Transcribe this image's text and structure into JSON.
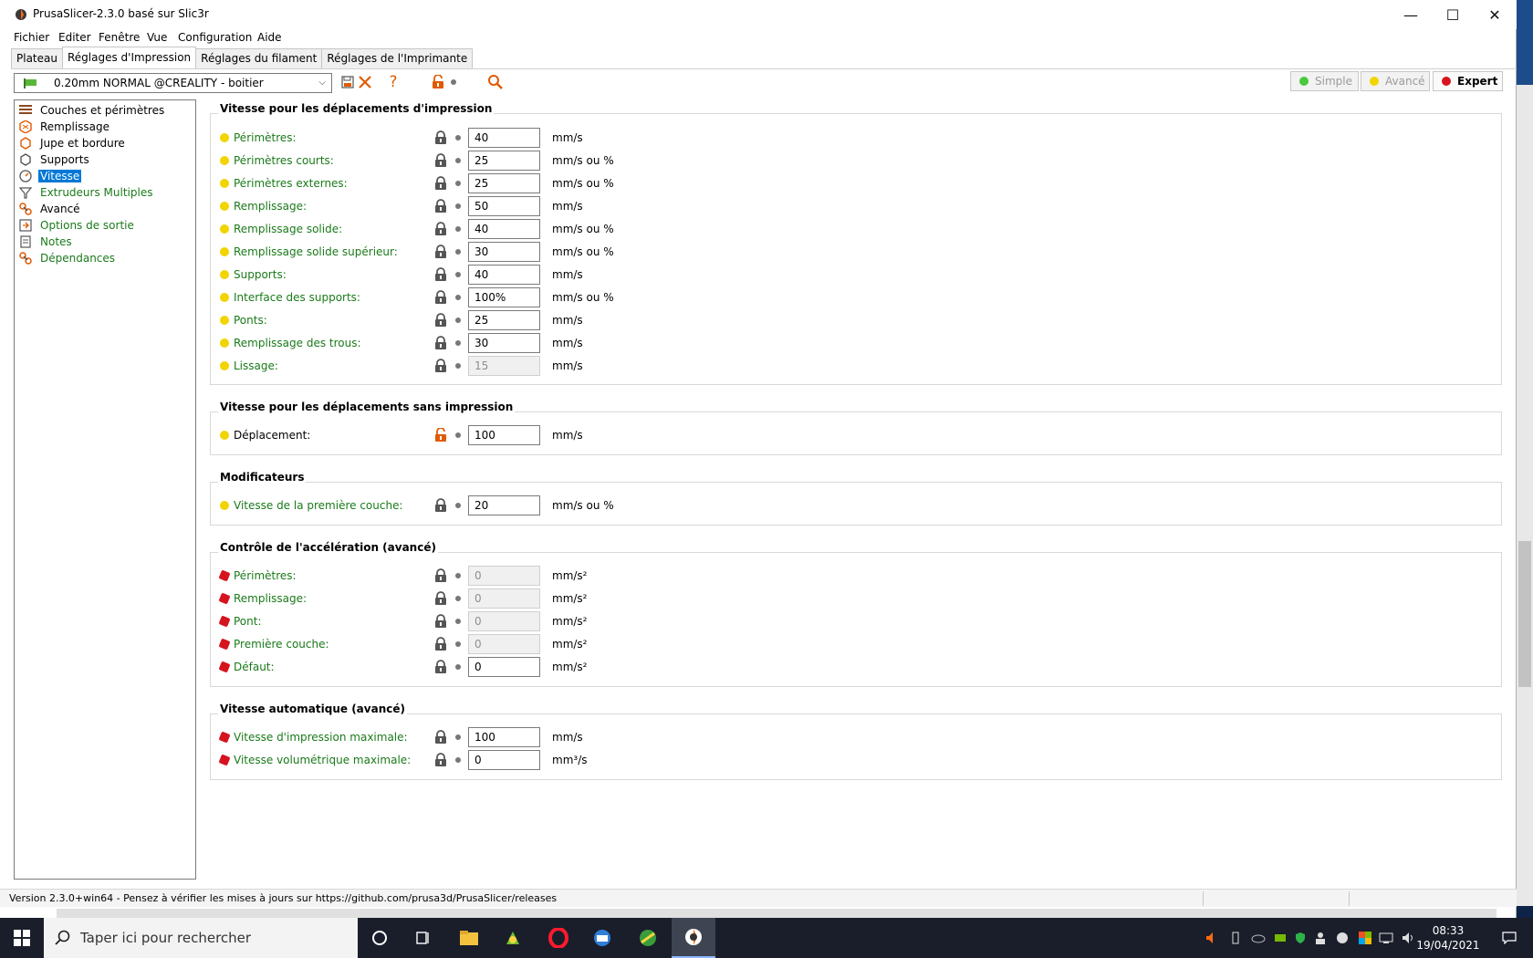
{
  "window": {
    "title": "PrusaSlicer-2.3.0 basé sur Slic3r",
    "controls": {
      "minimize": "—",
      "maximize": "☐",
      "close": "✕"
    }
  },
  "menu": [
    "Fichier",
    "Editer",
    "Fenêtre",
    "Vue",
    "Configuration",
    "Aide"
  ],
  "tabs": [
    {
      "label": "Plateau",
      "active": false
    },
    {
      "label": "Réglages d'Impression",
      "active": true
    },
    {
      "label": "Réglages du filament",
      "active": false
    },
    {
      "label": "Réglages de l'Imprimante",
      "active": false
    }
  ],
  "preset": {
    "name": "0.20mm NORMAL @CREALITY - boitier",
    "icon": "green-flag-icon"
  },
  "toolbar": {
    "save_icon": "save-icon",
    "delete_icon": "delete-x-icon",
    "help_label": "?",
    "lock_icon": "unlock-icon",
    "search_icon": "search-icon"
  },
  "modes": [
    {
      "label": "Simple",
      "color": "#49c93b",
      "active": false
    },
    {
      "label": "Avancé",
      "color": "#f2d400",
      "active": false
    },
    {
      "label": "Expert",
      "color": "#d6141e",
      "active": true
    }
  ],
  "sidebar": [
    {
      "label": "Couches et périmètres",
      "icon": "layers-icon",
      "green": false,
      "selected": false
    },
    {
      "label": "Remplissage",
      "icon": "infill-icon",
      "green": false,
      "selected": false
    },
    {
      "label": "Jupe et bordure",
      "icon": "skirt-icon",
      "green": false,
      "selected": false
    },
    {
      "label": "Supports",
      "icon": "support-icon",
      "green": false,
      "selected": false
    },
    {
      "label": "Vitesse",
      "icon": "speed-gauge-icon",
      "green": false,
      "selected": true
    },
    {
      "label": "Extrudeurs Multiples",
      "icon": "funnel-icon",
      "green": true,
      "selected": false
    },
    {
      "label": "Avancé",
      "icon": "wrench-icon",
      "green": false,
      "selected": false
    },
    {
      "label": "Options de sortie",
      "icon": "output-icon",
      "green": true,
      "selected": false
    },
    {
      "label": "Notes",
      "icon": "note-icon",
      "green": true,
      "selected": false
    },
    {
      "label": "Dépendances",
      "icon": "wrench-icon",
      "green": true,
      "selected": false
    }
  ],
  "groups": [
    {
      "title": "Vitesse pour les déplacements d'impression",
      "rows": [
        {
          "label": "Périmètres:",
          "value": "40",
          "unit": "mm/s",
          "bullet": "yellow",
          "disabled": false,
          "green": true,
          "unlocked": false
        },
        {
          "label": "Périmètres courts:",
          "value": "25",
          "unit": "mm/s ou %",
          "bullet": "yellow",
          "disabled": false,
          "green": true,
          "unlocked": false
        },
        {
          "label": "Périmètres externes:",
          "value": "25",
          "unit": "mm/s ou %",
          "bullet": "yellow",
          "disabled": false,
          "green": true,
          "unlocked": false
        },
        {
          "label": "Remplissage:",
          "value": "50",
          "unit": "mm/s",
          "bullet": "yellow",
          "disabled": false,
          "green": true,
          "unlocked": false
        },
        {
          "label": "Remplissage solide:",
          "value": "40",
          "unit": "mm/s ou %",
          "bullet": "yellow",
          "disabled": false,
          "green": true,
          "unlocked": false
        },
        {
          "label": "Remplissage solide supérieur:",
          "value": "30",
          "unit": "mm/s ou %",
          "bullet": "yellow",
          "disabled": false,
          "green": true,
          "unlocked": false
        },
        {
          "label": "Supports:",
          "value": "40",
          "unit": "mm/s",
          "bullet": "yellow",
          "disabled": false,
          "green": true,
          "unlocked": false
        },
        {
          "label": "Interface des supports:",
          "value": "100%",
          "unit": "mm/s ou %",
          "bullet": "yellow",
          "disabled": false,
          "green": true,
          "unlocked": false
        },
        {
          "label": "Ponts:",
          "value": "25",
          "unit": "mm/s",
          "bullet": "yellow",
          "disabled": false,
          "green": true,
          "unlocked": false
        },
        {
          "label": "Remplissage des trous:",
          "value": "30",
          "unit": "mm/s",
          "bullet": "yellow",
          "disabled": false,
          "green": true,
          "unlocked": false
        },
        {
          "label": "Lissage:",
          "value": "15",
          "unit": "mm/s",
          "bullet": "yellow",
          "disabled": true,
          "green": true,
          "unlocked": false
        }
      ]
    },
    {
      "title": "Vitesse pour les déplacements sans impression",
      "rows": [
        {
          "label": "Déplacement:",
          "value": "100",
          "unit": "mm/s",
          "bullet": "yellow",
          "disabled": false,
          "green": false,
          "unlocked": true
        }
      ]
    },
    {
      "title": "Modificateurs",
      "rows": [
        {
          "label": "Vitesse de la première couche:",
          "value": "20",
          "unit": "mm/s ou %",
          "bullet": "yellow",
          "disabled": false,
          "green": true,
          "unlocked": false
        }
      ]
    },
    {
      "title": "Contrôle de l'accélération (avancé)",
      "rows": [
        {
          "label": "Périmètres:",
          "value": "0",
          "unit": "mm/s²",
          "bullet": "red",
          "disabled": true,
          "green": true,
          "unlocked": false
        },
        {
          "label": "Remplissage:",
          "value": "0",
          "unit": "mm/s²",
          "bullet": "red",
          "disabled": true,
          "green": true,
          "unlocked": false
        },
        {
          "label": "Pont:",
          "value": "0",
          "unit": "mm/s²",
          "bullet": "red",
          "disabled": true,
          "green": true,
          "unlocked": false
        },
        {
          "label": "Première couche:",
          "value": "0",
          "unit": "mm/s²",
          "bullet": "red",
          "disabled": true,
          "green": true,
          "unlocked": false
        },
        {
          "label": "Défaut:",
          "value": "0",
          "unit": "mm/s²",
          "bullet": "red",
          "disabled": false,
          "green": true,
          "unlocked": false
        }
      ]
    },
    {
      "title": "Vitesse automatique (avancé)",
      "rows": [
        {
          "label": "Vitesse d'impression maximale:",
          "value": "100",
          "unit": "mm/s",
          "bullet": "red",
          "disabled": false,
          "green": true,
          "unlocked": false
        },
        {
          "label": "Vitesse volumétrique maximale:",
          "value": "0",
          "unit": "mm³/s",
          "bullet": "red",
          "disabled": false,
          "green": true,
          "unlocked": false
        }
      ]
    }
  ],
  "status": "Version 2.3.0+win64 - Pensez à vérifier les mises à jours sur https://github.com/prusa3d/PrusaSlicer/releases",
  "taskbar": {
    "search_placeholder": "Taper ici pour rechercher",
    "time": "08:33",
    "date": "19/04/2021",
    "apps": [
      "cortana-icon",
      "task-view-icon",
      "file-explorer-icon",
      "app-icon",
      "opera-icon",
      "app-icon",
      "app-icon",
      "prusaslicer-icon"
    ]
  }
}
